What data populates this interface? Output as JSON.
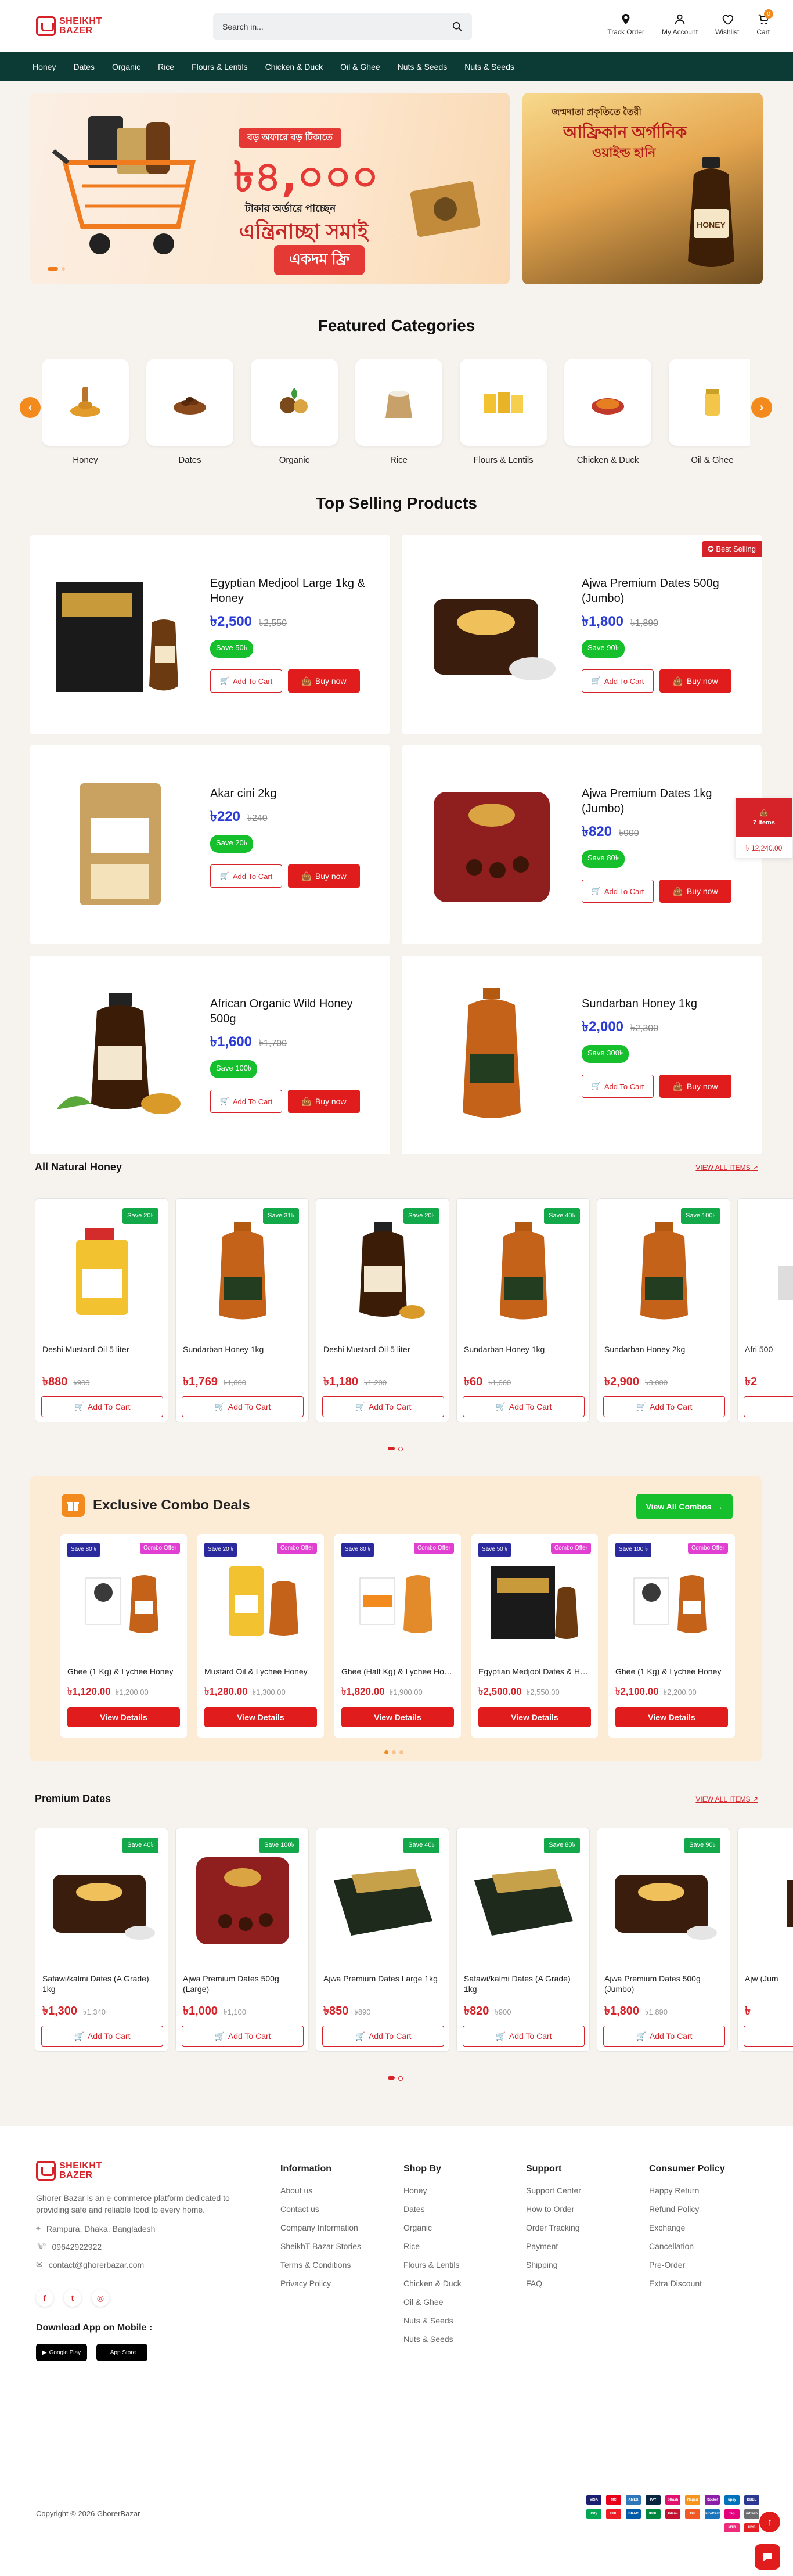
{
  "header": {
    "logo_line1": "SHEIKHT",
    "logo_line2": "BAZER",
    "search_placeholder": "Search in...",
    "actions": [
      {
        "label": "Track Order",
        "icon": "location-pin-icon"
      },
      {
        "label": "My Account",
        "icon": "user-icon"
      },
      {
        "label": "Wishlist",
        "icon": "heart-icon"
      },
      {
        "label": "Cart",
        "icon": "cart-icon"
      }
    ],
    "cart_count": "0"
  },
  "nav": [
    "Honey",
    "Dates",
    "Organic",
    "Rice",
    "Flours & Lentils",
    "Chicken & Duck",
    "Oil & Ghee",
    "Nuts & Seeds",
    "Nuts & Seeds"
  ],
  "hero": {
    "main_small_line": "বড় অফারে বড় টিকাতে",
    "main_big_number": "৳৪,০০০",
    "main_line_2": "টাকার অর্ডারে পাচ্ছেন",
    "main_line_3": "এন্ত্রিনাচ্ছা সমাই",
    "main_line_4": "একদম ফ্রি",
    "side_line_1": "জন্মদাতা প্রকৃতিতে তৈরী",
    "side_line_2": "আফ্রিকান অর্গানিক",
    "side_line_3": "ওয়াইল্ড হানি",
    "side_label": "HONEY"
  },
  "featured": {
    "title": "Featured Categories",
    "items": [
      {
        "label": "Honey"
      },
      {
        "label": "Dates"
      },
      {
        "label": "Organic"
      },
      {
        "label": "Rice"
      },
      {
        "label": "Flours & Lentils"
      },
      {
        "label": "Chicken & Duck"
      },
      {
        "label": "Oil & Ghee"
      }
    ]
  },
  "top_selling": {
    "title": "Top Selling Products",
    "add_label": "Add To Cart",
    "buy_label": "Buy now",
    "best_label": "Best Selling",
    "items": [
      {
        "name": "Egyptian Medjool Large 1kg & Honey",
        "price": "৳2,500",
        "old": "৳2,550",
        "save": "Save 50৳"
      },
      {
        "name": "Ajwa Premium Dates 500g (Jumbo)",
        "price": "৳1,800",
        "old": "৳1,890",
        "save": "Save 90৳"
      },
      {
        "name": "Akar cini 2kg",
        "price": "৳220",
        "old": "৳240",
        "save": "Save 20৳"
      },
      {
        "name": "Ajwa Premium Dates 1kg (Jumbo)",
        "price": "৳820",
        "old": "৳900",
        "save": "Save 80৳"
      },
      {
        "name": "African Organic Wild Honey 500g",
        "price": "৳1,600",
        "old": "৳1,700",
        "save": "Save 100৳"
      },
      {
        "name": "Sundarban Honey 1kg",
        "price": "৳2,000",
        "old": "৳2,300",
        "save": "Save 300৳"
      }
    ]
  },
  "honey_row": {
    "title": "All Natural Honey",
    "view_all": "VIEW ALL ITEMS",
    "add_label": "Add To Cart",
    "items": [
      {
        "name": "Deshi Mustard Oil 5 liter",
        "price": "৳880",
        "old": "৳900",
        "save": "Save 20৳"
      },
      {
        "name": "Sundarban Honey 1kg",
        "price": "৳1,769",
        "old": "৳1,800",
        "save": "Save 31৳"
      },
      {
        "name": "Deshi Mustard Oil 5 liter",
        "price": "৳1,180",
        "old": "৳1,200",
        "save": "Save 20৳"
      },
      {
        "name": "Sundarban Honey 1kg",
        "price": "৳60",
        "old": "৳1,660",
        "save": "Save 40৳"
      },
      {
        "name": "Sundarban Honey 2kg",
        "price": "৳2,900",
        "old": "৳3,000",
        "save": "Save 100৳"
      },
      {
        "name": "Afri 500",
        "price": "৳2",
        "old": "",
        "save": ""
      }
    ]
  },
  "combo": {
    "title": "Exclusive Combo Deals",
    "view_all": "View All Combos",
    "details_label": "View Details",
    "tag_label": "Combo Offer",
    "items": [
      {
        "name": "Ghee (1 Kg) & Lychee Honey",
        "price": "৳1,120.00",
        "old": "৳1,200.00",
        "save": "Save 80 ৳"
      },
      {
        "name": "Mustard Oil & Lychee Honey",
        "price": "৳1,280.00",
        "old": "৳1,300.00",
        "save": "Save 20 ৳"
      },
      {
        "name": "Ghee (Half Kg) & Lychee Honey",
        "price": "৳1,820.00",
        "old": "৳1,900.00",
        "save": "Save 80 ৳"
      },
      {
        "name": "Egyptian Medjool Dates & Honey",
        "price": "৳2,500.00",
        "old": "৳2,550.00",
        "save": "Save 50 ৳"
      },
      {
        "name": "Ghee (1 Kg) & Lychee Honey",
        "price": "৳2,100.00",
        "old": "৳2,200.00",
        "save": "Save 100 ৳"
      }
    ]
  },
  "dates_row": {
    "title": "Premium Dates",
    "view_all": "VIEW ALL ITEMS",
    "add_label": "Add To Cart",
    "items": [
      {
        "name": "Safawi/kalmi Dates (A Grade) 1kg",
        "price": "৳1,300",
        "old": "৳1,340",
        "save": "Save 40৳"
      },
      {
        "name": "Ajwa Premium Dates 500g (Large)",
        "price": "৳1,000",
        "old": "৳1,100",
        "save": "Save 100৳"
      },
      {
        "name": "Ajwa Premium Dates Large 1kg",
        "price": "৳850",
        "old": "৳890",
        "save": "Save 40৳"
      },
      {
        "name": "Safawi/kalmi Dates (A Grade) 1kg",
        "price": "৳820",
        "old": "৳900",
        "save": "Save 80৳"
      },
      {
        "name": "Ajwa Premium Dates 500g (Jumbo)",
        "price": "৳1,800",
        "old": "৳1,890",
        "save": "Save 90৳"
      },
      {
        "name": "Ajw (Jum",
        "price": "৳",
        "old": "",
        "save": ""
      }
    ]
  },
  "side_cart": {
    "items": "7 Items",
    "amount": "৳ 12,240.00"
  },
  "footer": {
    "description": "Ghorer Bazar is an e-commerce platform dedicated to providing safe and reliable food to every home.",
    "address": "Rampura, Dhaka, Bangladesh",
    "phone": "09642922922",
    "email": "contact@ghorerbazar.com",
    "app_title": "Download App on Mobile :",
    "google_play": "Google Play",
    "app_store": "App Store",
    "copyright": "Copyright © 2026 GhorerBazar",
    "columns": [
      {
        "title": "Information",
        "links": [
          "About us",
          "Contact us",
          "Company Information",
          "SheikhT Bazar Stories",
          "Terms & Conditions",
          "Privacy Policy"
        ]
      },
      {
        "title": "Shop By",
        "links": [
          "Honey",
          "Dates",
          "Organic",
          "Rice",
          "Flours & Lentils",
          "Chicken & Duck",
          "Oil & Ghee",
          "Nuts & Seeds",
          "Nuts & Seeds"
        ]
      },
      {
        "title": "Support",
        "links": [
          "Support Center",
          "How to Order",
          "Order Tracking",
          "Payment",
          "Shipping",
          "FAQ"
        ]
      },
      {
        "title": "Consumer Policy",
        "links": [
          "Happy Return",
          "Refund Policy",
          "Exchange",
          "Cancellation",
          "Pre-Order",
          "Extra Discount"
        ]
      }
    ],
    "payments": [
      "VISA",
      "MC",
      "AMEX",
      "PAY",
      "bKash",
      "Nagad",
      "Rocket",
      "upay",
      "DBBL",
      "City",
      "EBL",
      "BRAC",
      "IBBL",
      "Islami",
      "OK",
      "SureCash",
      "tap",
      "mCash",
      "MTB",
      "UCB"
    ]
  }
}
